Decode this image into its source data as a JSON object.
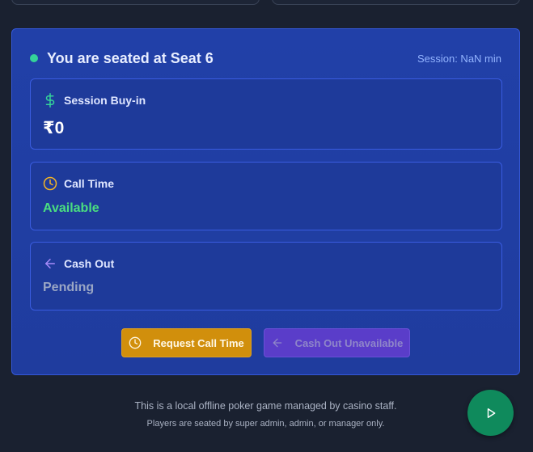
{
  "seat": {
    "title": "You are seated at Seat 6",
    "session_label": "Session: NaN min",
    "status_color": "#34d399"
  },
  "cards": {
    "buyin": {
      "label": "Session Buy-in",
      "value": "₹0",
      "icon": "dollar-icon"
    },
    "call_time": {
      "label": "Call Time",
      "value": "Available",
      "icon": "clock-icon"
    },
    "cash_out": {
      "label": "Cash Out",
      "value": "Pending",
      "icon": "arrow-left-icon"
    }
  },
  "actions": {
    "request_call_time": "Request Call Time",
    "cash_out_unavailable": "Cash Out Unavailable"
  },
  "footer": {
    "line1": "This is a local offline poker game managed by casino staff.",
    "line2": "Players are seated by super admin, admin, or manager only."
  },
  "fab": {
    "icon": "play-icon"
  }
}
